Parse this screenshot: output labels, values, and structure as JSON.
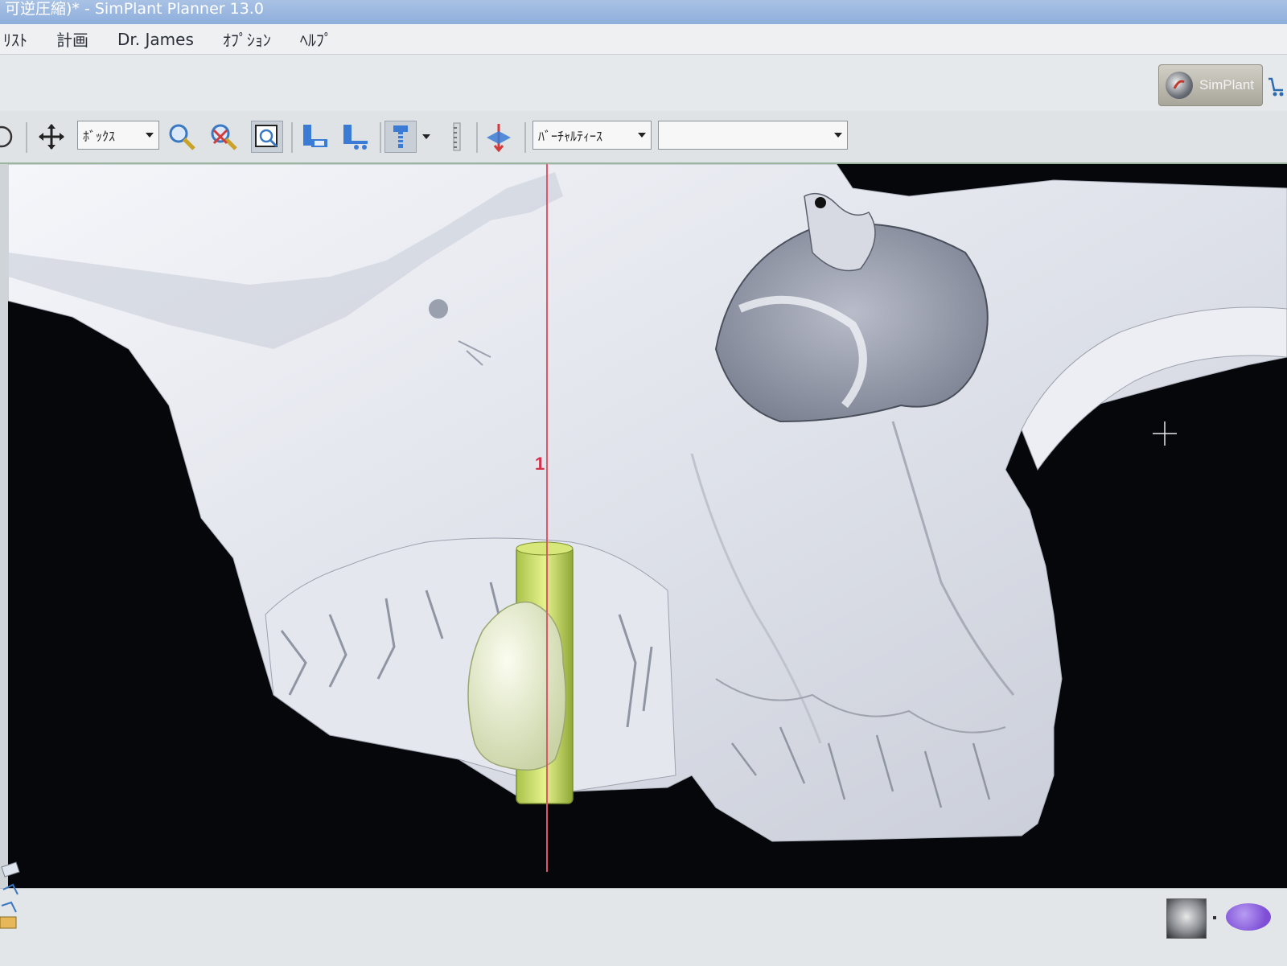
{
  "window": {
    "title": "可逆圧縮)* - SimPlant Planner  13.0"
  },
  "menu": {
    "items": [
      "ﾘｽﾄ",
      "計画",
      "Dr. James",
      "ｵﾌﾟｼｮﾝ",
      "ﾍﾙﾌﾟ"
    ]
  },
  "ribbon": {
    "simplant_label": "SimPlant"
  },
  "toolbar": {
    "view_mode_select": "ﾎﾞｯｸｽ",
    "virtual_teeth_select": "ﾊﾞｰﾁｬﾙﾃｨｰｽ",
    "secondary_select": ""
  },
  "viewport": {
    "implant_number": "1",
    "colors": {
      "background": "#05070a",
      "bone": "#e9ecf3",
      "implant": "#c9e26a",
      "crown": "#e8efcf",
      "cross_section_line": "#e0556a"
    }
  }
}
